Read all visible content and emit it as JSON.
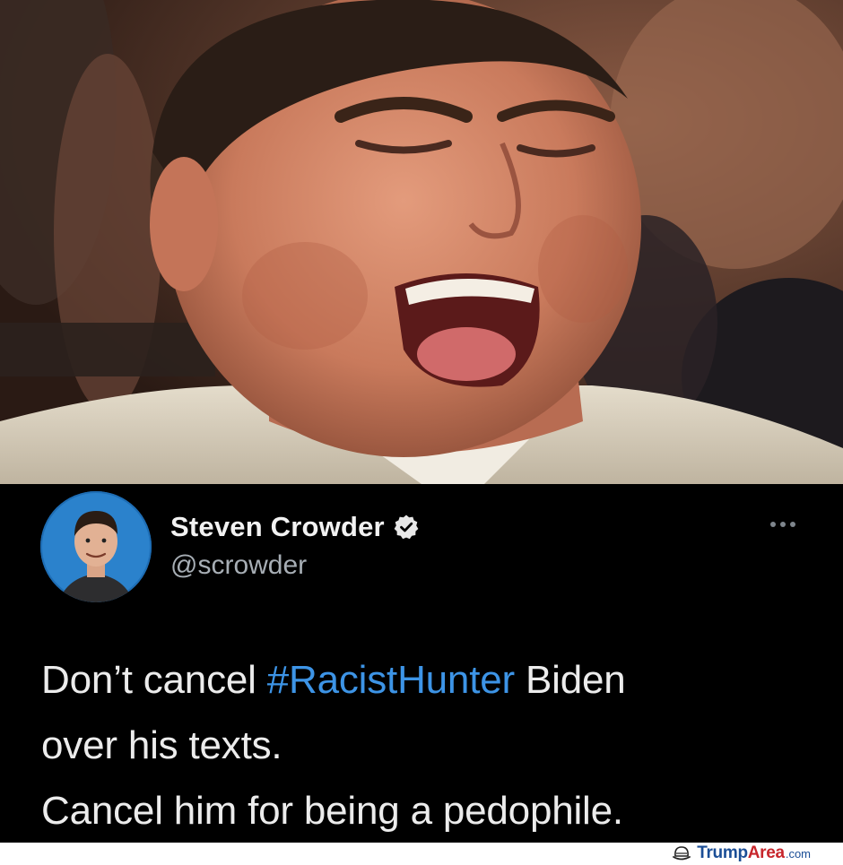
{
  "photo": {
    "description_icon": "laughing-man-photo"
  },
  "tweet": {
    "author": {
      "display_name": "Steven Crowder",
      "handle": "@scrowder",
      "verified": true,
      "avatar_icon": "profile-photo"
    },
    "more_icon": "ellipsis-icon",
    "text": {
      "line1_before": "Don’t cancel ",
      "line1_hashtag": "#RacistHunter",
      "line1_after": " Biden",
      "line2": "over his texts.",
      "line3": "Cancel him for being a pedophile."
    }
  },
  "watermark": {
    "icon": "hat-icon",
    "part1": "Trump",
    "part2": "Area",
    "part3": ".com"
  },
  "colors": {
    "background": "#000000",
    "hashtag": "#3d94e6",
    "handle": "#a7aeb5",
    "watermark_blue": "#1b4e96",
    "watermark_red": "#c7262c"
  }
}
